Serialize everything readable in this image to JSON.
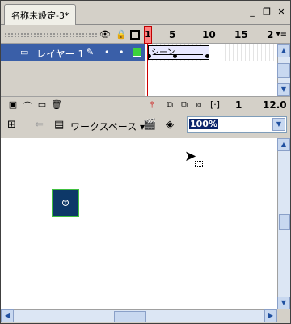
{
  "document": {
    "tab_title": "名称未設定-3*"
  },
  "window_controls": {
    "minimize": "_",
    "restore": "❐",
    "close": "✕"
  },
  "timeline": {
    "header_icons": [
      "eye-icon",
      "lock-icon",
      "outline-icon"
    ],
    "ruler": [
      "1",
      "5",
      "10",
      "15",
      "2"
    ],
    "menu_symbol": "▾≡",
    "layer": {
      "name": "レイヤー 1",
      "color": "#3cd23c"
    },
    "tween_label": "シーン",
    "current_frame": "1",
    "fps": "12.0"
  },
  "editbar": {
    "workspace_label": "ワークスペース ▾",
    "zoom_value": "100%"
  },
  "stage": {
    "symbol_fill": "#0d3868"
  },
  "colors": {
    "chrome": "#d4d0c8",
    "selected_layer": "#3a5fa8",
    "playhead": "#cc0000"
  }
}
